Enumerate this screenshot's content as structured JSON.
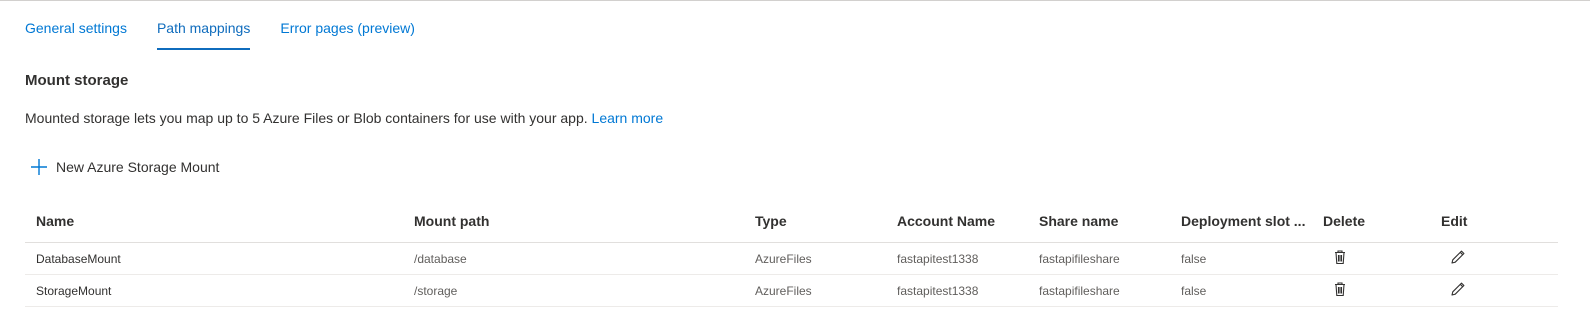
{
  "tabs": [
    {
      "label": "General settings",
      "active": false
    },
    {
      "label": "Path mappings",
      "active": true
    },
    {
      "label": "Error pages (preview)",
      "active": false
    }
  ],
  "section": {
    "title": "Mount storage",
    "description": "Mounted storage lets you map up to 5 Azure Files or Blob containers for use with your app.",
    "learn_more": "Learn more"
  },
  "new_button": {
    "label": "New Azure Storage Mount",
    "icon": "plus-icon"
  },
  "table": {
    "headers": [
      "Name",
      "Mount path",
      "Type",
      "Account Name",
      "Share name",
      "Deployment slot ...",
      "Delete",
      "Edit"
    ],
    "rows": [
      {
        "name": "DatabaseMount",
        "mount_path": "/database",
        "type": "AzureFiles",
        "account": "fastapitest1338",
        "share": "fastapifileshare",
        "slot": "false"
      },
      {
        "name": "StorageMount",
        "mount_path": "/storage",
        "type": "AzureFiles",
        "account": "fastapitest1338",
        "share": "fastapifileshare",
        "slot": "false"
      }
    ]
  },
  "colors": {
    "accent": "#0078d4",
    "text": "#323130",
    "muted": "#605e5c"
  }
}
